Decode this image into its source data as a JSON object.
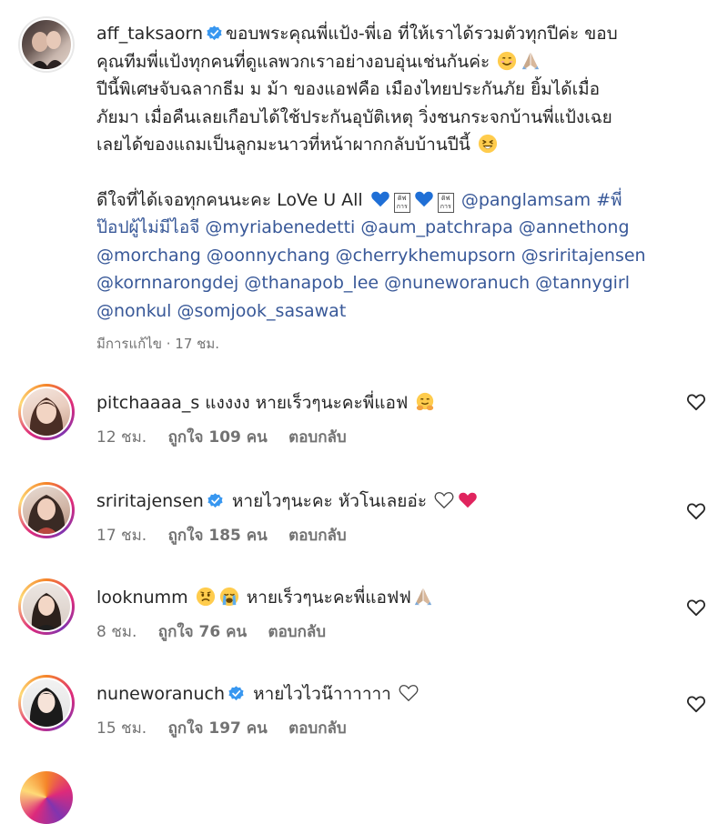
{
  "caption": {
    "username": "aff_taksaorn",
    "line1_rest": "ขอบพระคุณพี่แป้ง-พี่เอ ที่ให้เราได้รวมตัวทุกปีค่ะ ขอบ",
    "line2": "คุณทีมพี่แป้งทุกคนที่ดูแลพวกเราอย่างอบอุ่นเช่นกันค่ะ",
    "line3": "ปีนี้พิเศษจับฉลากธีม ม ม้า ของแอฟคือ เมืองไทยประกันภัย ยิ้มได้เมื่อ",
    "line4": "ภัยมา เมื่อคืนเลยเกือบได้ใช้ประกันอุบัติเหตุ วิ่งชนกระจกบ้านพี่แป้งเฉย",
    "line5": "เลยได้ของแถมเป็นลูกมะนาวที่หน้าผากกลับบ้านปีนี้",
    "para2_start": "ดีใจที่ได้เจอทุกคนนะคะ LoVe U All",
    "emoji_box_text": "ดิฟ การ",
    "mention_line1": "@panglamsam #พี่",
    "mention_line2": "ป๊อปผู้ไม่มีไอจี @myriabenedetti @aum_patchrapa @annethong",
    "mention_line3": "@morchang @oonnychang @cherrykhemupsorn @sriritajensen",
    "mention_line4": "@kornnarongdej @thanapob_lee @nuneworanuch @tannygirl",
    "mention_line5": "@nonkul @somjook_sasawat",
    "meta": "มีการแก้ไข · 17 ชม."
  },
  "comments": [
    {
      "username": "pitchaaaa_s",
      "verified": false,
      "text": "แงงงง หายเร็วๆนะคะพี่แอฟ",
      "time": "12 ชม.",
      "likes": "ถูกใจ 109 คน",
      "reply": "ตอบกลับ"
    },
    {
      "username": "sriritajensen",
      "verified": true,
      "text": "หายไวๆนะคะ หัวโนเลยอ่ะ",
      "time": "17 ชม.",
      "likes": "ถูกใจ 185 คน",
      "reply": "ตอบกลับ"
    },
    {
      "username": "looknumm",
      "verified": false,
      "text": "หายเร็วๆนะคะพี่แอฟฟ",
      "time": "8 ชม.",
      "likes": "ถูกใจ 76 คน",
      "reply": "ตอบกลับ"
    },
    {
      "username": "nuneworanuch",
      "verified": true,
      "text": "หายไวไวน๊าาาาาา",
      "time": "15 ชม.",
      "likes": "ถูกใจ 197 คน",
      "reply": "ตอบกลับ"
    }
  ],
  "colors": {
    "mention": "#385898",
    "verified": "#3897f0",
    "meta": "#737373",
    "red_heart": "#e0245e"
  },
  "icons": [
    "verified-badge-icon",
    "heart-outline-icon",
    "red-heart-icon",
    "smile-emoji-icon",
    "praying-hands-emoji-icon",
    "blue-heart-emoji-icon",
    "crying-emoji-icon",
    "sad-emoji-icon",
    "laughing-emoji-icon",
    "hugging-emoji-icon"
  ]
}
